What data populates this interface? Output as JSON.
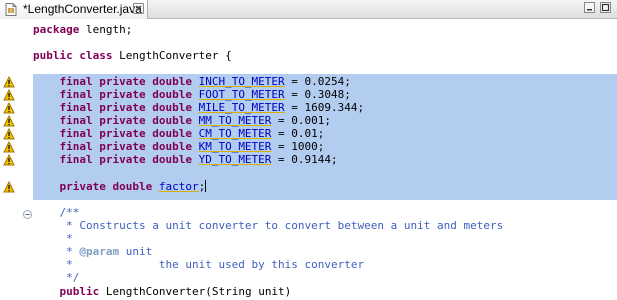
{
  "tab": {
    "title": "*LengthConverter.java",
    "close_icon": "close-icon",
    "file_icon": "java-file-icon"
  },
  "window_controls": {
    "minimize": "minimize-icon",
    "maximize": "maximize-icon"
  },
  "colors": {
    "keyword": "#7f0055",
    "field": "#0000c0",
    "comment": "#3f5fbf",
    "javadoc_tag": "#7f9fbf",
    "selection": "#b3cdf1",
    "warning_marker": "#e8b800"
  },
  "code": {
    "l1": {
      "kw": "package",
      "rest": " length;"
    },
    "l3": {
      "kw1": "public",
      "kw2": "class",
      "rest": " LengthConverter {"
    },
    "const_kw": "final private double",
    "constants": [
      {
        "name": "INCH_TO_METER",
        "value": " = 0.0254;"
      },
      {
        "name": "FOOT_TO_METER",
        "value": " = 0.3048;"
      },
      {
        "name": "MILE_TO_METER",
        "value": " = 1609.344;"
      },
      {
        "name": "MM_TO_METER",
        "value": " = 0.001;"
      },
      {
        "name": "CM_TO_METER",
        "value": " = 0.01;"
      },
      {
        "name": "KM_TO_METER",
        "value": " = 1000;"
      },
      {
        "name": "YD_TO_METER",
        "value": " = 0.9144;"
      }
    ],
    "factor": {
      "kw": "private double",
      "name": "factor",
      "end": ";"
    },
    "javadoc": {
      "open": "/**",
      "line1": " * Constructs a unit converter to convert between a unit and meters",
      "star": " *",
      "param_prefix": " * ",
      "param_tag": "@param",
      "param_name": " unit",
      "param_desc": " *             the unit used by this converter",
      "close": " */"
    },
    "ctor": {
      "kw": "public",
      "rest": " LengthConverter(String unit)"
    }
  }
}
